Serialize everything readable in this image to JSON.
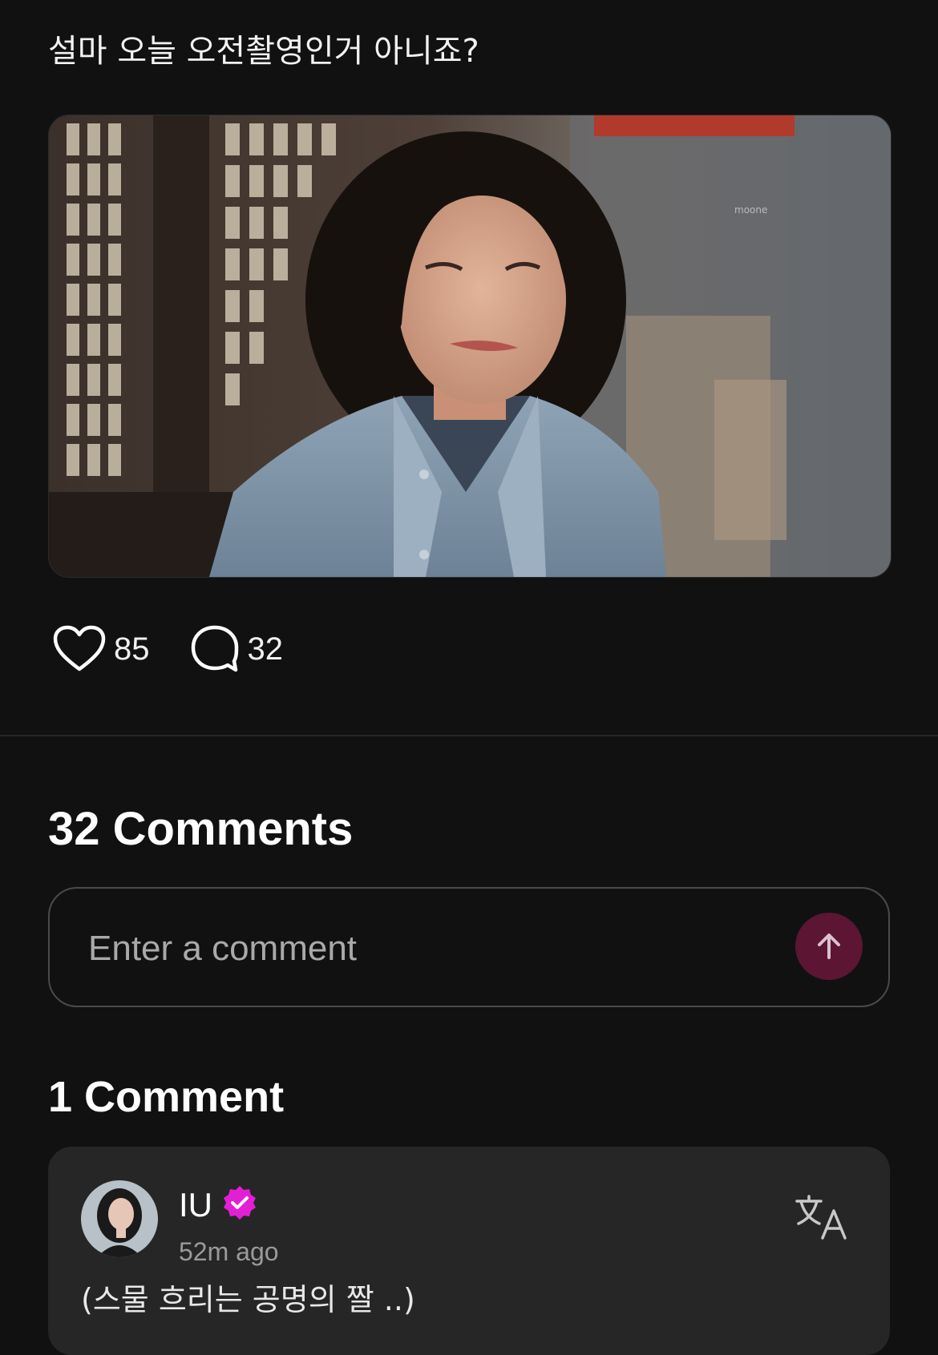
{
  "post": {
    "text": "설마 오늘 오전촬영인거 아니죠?",
    "image_description": "Photo of a tearful woman in a denim shirt",
    "likes": "85",
    "comments_count": "32"
  },
  "comments_section": {
    "heading": "32 Comments",
    "input_placeholder": "Enter a comment",
    "send_icon": "arrow-up-icon",
    "send_color": "#5c1533"
  },
  "artist_comments": {
    "heading": "1 Comment",
    "items": [
      {
        "author": "IU",
        "verified": true,
        "verified_color": "#e31fd6",
        "time": "52m ago",
        "text": "(스물 흐리는 공명의 짤 ..)",
        "translate_icon": "translate-icon"
      }
    ]
  }
}
